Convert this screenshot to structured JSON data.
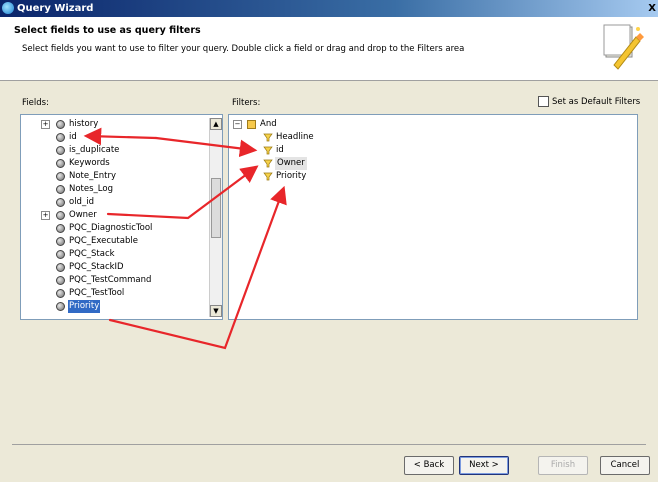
{
  "window": {
    "title": "Query Wizard",
    "close_glyph": "X"
  },
  "header": {
    "title": "Select fields to use as query filters",
    "description": "Select fields you want to use to filter your query. Double click a field or drag and drop to the Filters area"
  },
  "fields_panel": {
    "label": "Fields:",
    "items": [
      {
        "label": "history",
        "expander": "+"
      },
      {
        "label": "id",
        "expander": ""
      },
      {
        "label": "is_duplicate",
        "expander": ""
      },
      {
        "label": "Keywords",
        "expander": ""
      },
      {
        "label": "Note_Entry",
        "expander": ""
      },
      {
        "label": "Notes_Log",
        "expander": ""
      },
      {
        "label": "old_id",
        "expander": ""
      },
      {
        "label": "Owner",
        "expander": "+"
      },
      {
        "label": "PQC_DiagnosticTool",
        "expander": ""
      },
      {
        "label": "PQC_Executable",
        "expander": ""
      },
      {
        "label": "PQC_Stack",
        "expander": ""
      },
      {
        "label": "PQC_StackID",
        "expander": ""
      },
      {
        "label": "PQC_TestCommand",
        "expander": ""
      },
      {
        "label": "PQC_TestTool",
        "expander": ""
      },
      {
        "label": "Priority",
        "expander": "",
        "selected": true
      }
    ]
  },
  "filters_panel": {
    "label": "Filters:",
    "root": {
      "label": "And",
      "expander": "−"
    },
    "items": [
      {
        "label": "Headline"
      },
      {
        "label": "id"
      },
      {
        "label": "Owner",
        "highlighted": true
      },
      {
        "label": "Priority"
      }
    ]
  },
  "default_filters": {
    "label": "Set as Default Filters",
    "checked": false
  },
  "buttons": {
    "back": "< Back",
    "next": "Next >",
    "finish": "Finish",
    "cancel": "Cancel"
  },
  "colors": {
    "arrow": "#e8262a",
    "selection": "#316ac5",
    "title_bar": "#0a246a"
  },
  "icons": {
    "app": "query-wizard-icon",
    "field": "field-node-icon",
    "group": "and-group-icon",
    "filter": "filter-node-icon",
    "wand": "wizard-wand-icon"
  }
}
